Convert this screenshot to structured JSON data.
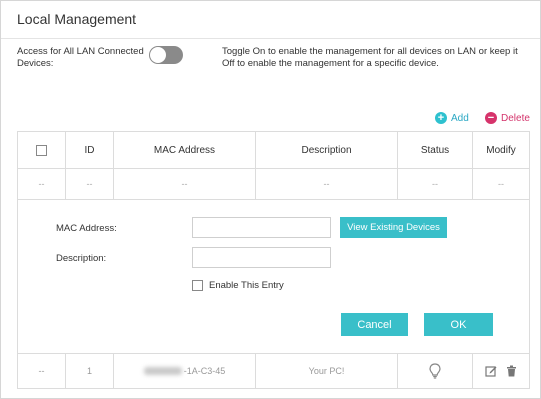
{
  "page": {
    "title": "Local Management"
  },
  "access": {
    "label": "Access for All LAN Connected Devices:",
    "toggle_state": "off",
    "help": "Toggle On to enable the management for all devices on LAN or keep it Off to enable the management for a specific device."
  },
  "actions": {
    "add_label": "Add",
    "delete_label": "Delete"
  },
  "table": {
    "headers": [
      "ID",
      "MAC Address",
      "Description",
      "Status",
      "Modify"
    ],
    "empty_row": [
      "--",
      "--",
      "--",
      "--",
      "--",
      "--"
    ],
    "rows": [
      {
        "select": "--",
        "id": "1",
        "mac": "-1A-C3-45",
        "description": "Your PC!",
        "status_icon": "lightbulb-icon",
        "modify_icons": [
          "edit-icon",
          "trash-icon"
        ]
      }
    ]
  },
  "form": {
    "mac_label": "MAC Address:",
    "mac_value": "",
    "view_devices_label": "View Existing Devices",
    "description_label": "Description:",
    "description_value": "",
    "enable_label": "Enable This Entry",
    "enable_checked": false,
    "cancel_label": "Cancel",
    "ok_label": "OK"
  },
  "colors": {
    "accent": "#39bfc9",
    "delete": "#d6336b",
    "toggle_off": "#8a8a8a"
  }
}
